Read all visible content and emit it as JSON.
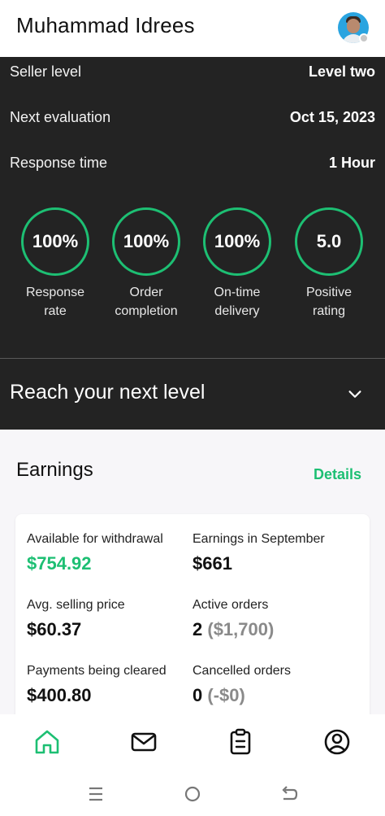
{
  "header": {
    "user_name": "Muhammad Idrees"
  },
  "seller": {
    "rows": [
      {
        "label": "Seller level",
        "value": "Level two"
      },
      {
        "label": "Next evaluation",
        "value": "Oct 15, 2023"
      },
      {
        "label": "Response time",
        "value": "1 Hour"
      }
    ],
    "stats": [
      {
        "value": "100%",
        "label_line1": "Response",
        "label_line2": "rate"
      },
      {
        "value": "100%",
        "label_line1": "Order",
        "label_line2": "completion"
      },
      {
        "value": "100%",
        "label_line1": "On-time",
        "label_line2": "delivery"
      },
      {
        "value": "5.0",
        "label_line1": "Positive",
        "label_line2": "rating"
      }
    ],
    "reach_label": "Reach your next level"
  },
  "earnings": {
    "title": "Earnings",
    "details_link": "Details",
    "items": [
      {
        "label": "Available for withdrawal",
        "value": "$754.92"
      },
      {
        "label": "Earnings in September",
        "value": "$661"
      },
      {
        "label": "Avg. selling price",
        "value": "$60.37"
      },
      {
        "label": "Active orders",
        "value": "2",
        "sub": "($1,700)"
      },
      {
        "label": "Payments being cleared",
        "value": "$400.80"
      },
      {
        "label": "Cancelled orders",
        "value": "0",
        "sub": "(-$0)"
      }
    ]
  },
  "nav": {
    "icons": [
      "home-icon",
      "messages-icon",
      "orders-icon",
      "profile-icon"
    ]
  },
  "colors": {
    "accent": "#1dbf73",
    "dark_panel": "#232323",
    "muted": "#8a8a8a"
  }
}
